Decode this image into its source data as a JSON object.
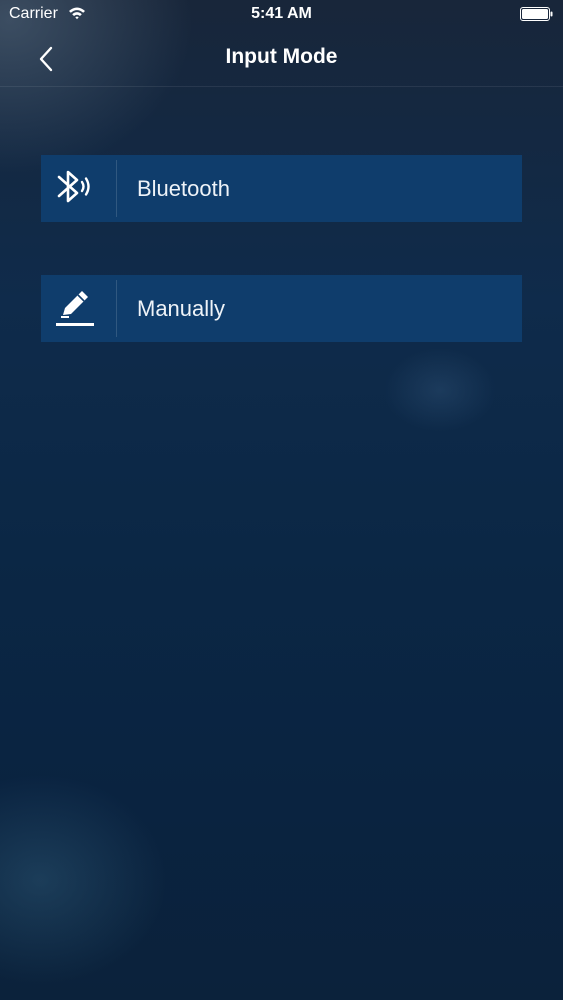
{
  "status_bar": {
    "carrier": "Carrier",
    "time": "5:41 AM",
    "wifi_icon": "wifi-icon",
    "battery_icon": "battery-icon"
  },
  "nav": {
    "title": "Input Mode",
    "back_icon": "chevron-left-icon"
  },
  "options": [
    {
      "label": "Bluetooth",
      "icon": "bluetooth-icon"
    },
    {
      "label": "Manually",
      "icon": "pencil-icon"
    }
  ],
  "colors": {
    "option_background": "#0f3d6c",
    "background_top": "#18263a",
    "background_bottom": "#0b223b",
    "text": "#ffffff"
  }
}
